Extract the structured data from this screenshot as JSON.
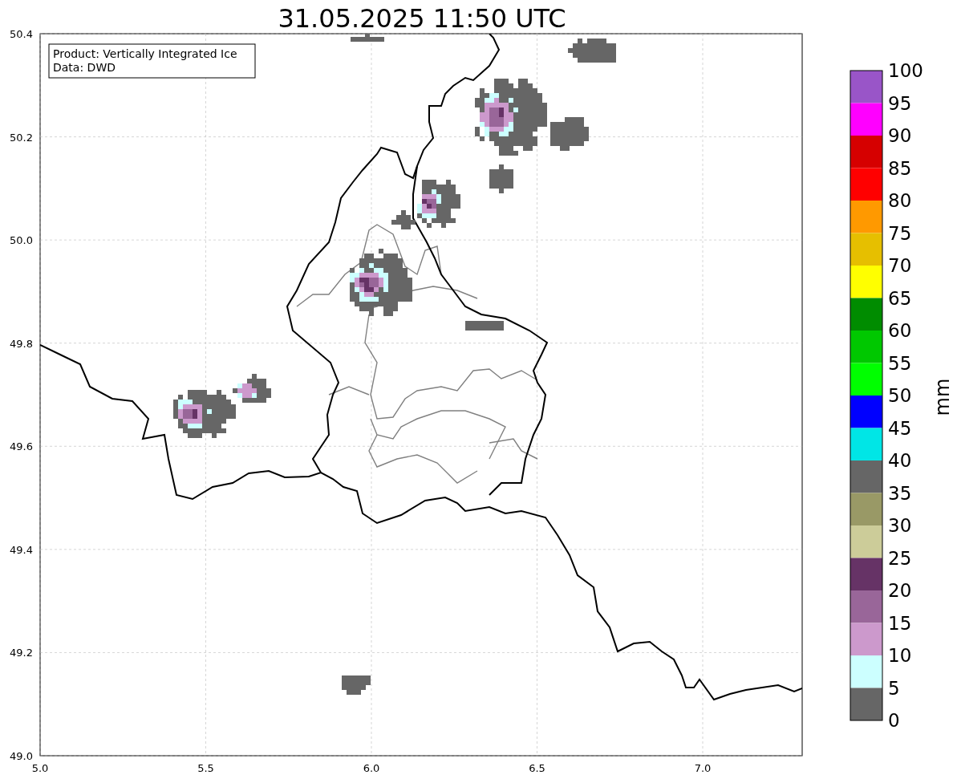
{
  "title": "31.05.2025 11:50 UTC",
  "info_box": {
    "lines": [
      "Product: Vertically Integrated Ice",
      "Data: DWD"
    ]
  },
  "map": {
    "x_ticks": [
      "5.0",
      "5.5",
      "6.0",
      "6.5",
      "7.0"
    ],
    "y_ticks": [
      "50.4",
      "50.2",
      "50.0",
      "49.8",
      "49.6",
      "49.4",
      "49.2",
      "49.0"
    ]
  },
  "colorbar": {
    "label": "mm",
    "bins": [
      {
        "color": "#9955c8"
      },
      {
        "color": "#ff00ff"
      },
      {
        "color": "#d60000"
      },
      {
        "color": "#ff0000"
      },
      {
        "color": "#ff9900"
      },
      {
        "color": "#e6bf00"
      },
      {
        "color": "#ffff00"
      },
      {
        "color": "#008c00"
      },
      {
        "color": "#00c800"
      },
      {
        "color": "#00ff00"
      },
      {
        "color": "#0000ff"
      },
      {
        "color": "#00e6e6"
      },
      {
        "color": "#666666"
      },
      {
        "color": "#999966"
      },
      {
        "color": "#cccc99"
      },
      {
        "color": "#663366"
      },
      {
        "color": "#996699"
      },
      {
        "color": "#cc99cc"
      },
      {
        "color": "#ccffff"
      },
      {
        "color": "#666666"
      }
    ],
    "tick_labels": [
      "100",
      "95",
      "90",
      "85",
      "80",
      "75",
      "70",
      "65",
      "60",
      "55",
      "50",
      "45",
      "40",
      "35",
      "30",
      "25",
      "20",
      "15",
      "10",
      "5",
      "0"
    ]
  }
}
